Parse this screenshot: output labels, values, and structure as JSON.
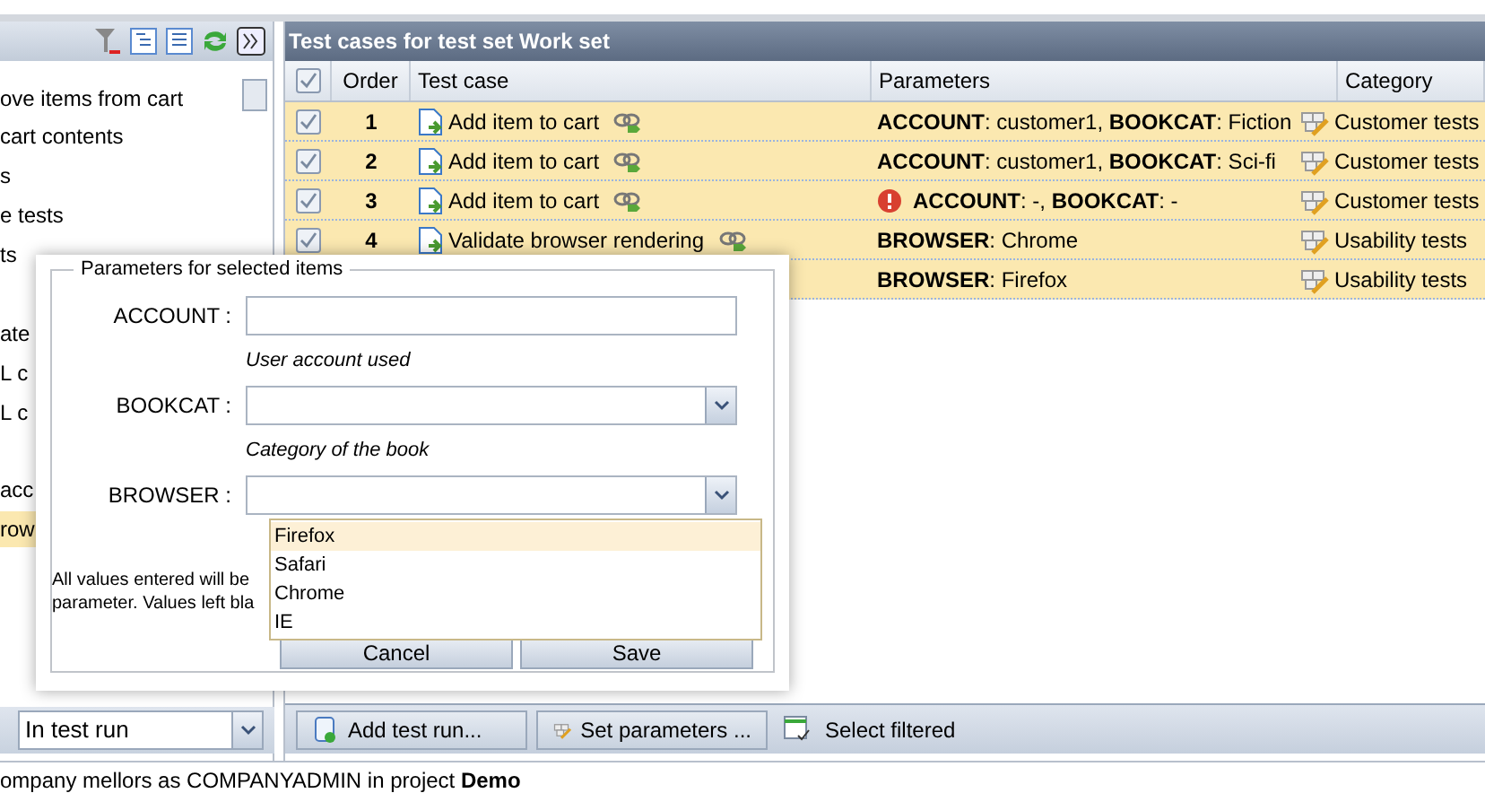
{
  "left_panel": {
    "tree_items": [
      {
        "label": "ove items from cart",
        "selected": false
      },
      {
        "label": "cart contents",
        "selected": false
      },
      {
        "label": "s",
        "selected": false
      },
      {
        "label": "e tests",
        "selected": false
      },
      {
        "label": "ts",
        "selected": false
      },
      {
        "label": "ate",
        "selected": false
      },
      {
        "label": "L c",
        "selected": false
      },
      {
        "label": "L c",
        "selected": false
      },
      {
        "label": "acc",
        "selected": false
      },
      {
        "label": "row",
        "selected": true
      }
    ],
    "filter_select": {
      "value": "In test run"
    }
  },
  "main_panel": {
    "title": "Test cases for test set **Work set**",
    "table": {
      "header_checked": true,
      "columns": [
        "Order",
        "Test case",
        "Parameters",
        "Category"
      ],
      "rows": [
        {
          "checked": true,
          "order": "1",
          "test_case": "Add item to cart",
          "warning": false,
          "parameters": "**ACCOUNT**: customer1, **BOOKCAT**: Fiction",
          "category": "Customer tests"
        },
        {
          "checked": true,
          "order": "2",
          "test_case": "Add item to cart",
          "warning": false,
          "parameters": "**ACCOUNT**: customer1, **BOOKCAT**: Sci-fi",
          "category": "Customer tests"
        },
        {
          "checked": true,
          "order": "3",
          "test_case": "Add item to cart",
          "warning": true,
          "parameters": "**ACCOUNT**: -, **BOOKCAT**: -",
          "category": "Customer tests"
        },
        {
          "checked": true,
          "order": "4",
          "test_case": "Validate browser rendering",
          "warning": false,
          "parameters": "**BROWSER**: Chrome",
          "category": "Usability tests"
        },
        {
          "parameters": "**BROWSER**: Firefox",
          "category": "Usability tests"
        }
      ]
    },
    "toolbar": [
      "Add test run...",
      "Set parameters ...",
      "Select filtered"
    ]
  },
  "dialog": {
    "legend": "Parameters for selected items",
    "fields": [
      {
        "kind": "text",
        "label": "ACCOUNT :",
        "hint": "User account used"
      },
      {
        "kind": "select",
        "label": "BOOKCAT :",
        "hint": "Category of the book"
      },
      {
        "kind": "select",
        "label": "BROWSER :"
      }
    ],
    "note": [
      "All values entered will be",
      "parameter. Values left bla"
    ],
    "dropdown_options": [
      {
        "label": "Firefox",
        "selected": true
      },
      {
        "label": "Safari",
        "selected": false
      },
      {
        "label": "Chrome",
        "selected": false
      },
      {
        "label": "IE",
        "selected": false
      }
    ],
    "buttons": [
      "Cancel",
      "Save"
    ]
  },
  "status_bar": "ompany mellors as COMPANYADMIN in project **Demo**"
}
